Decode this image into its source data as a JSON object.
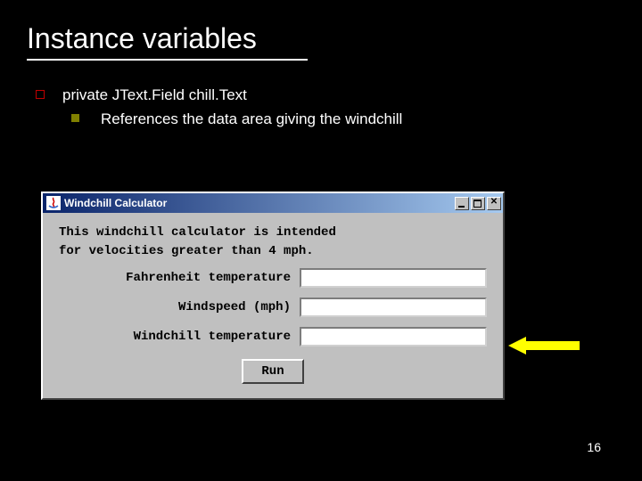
{
  "slide": {
    "title": "Instance variables",
    "page_number": "16"
  },
  "bullets": {
    "l1_text": "private JText.Field chill.Text",
    "l2_text": "References the data area giving the windchill"
  },
  "window": {
    "title": "Windchill Calculator",
    "intro_line1": "This windchill calculator is intended",
    "intro_line2": "for velocities greater than 4 mph.",
    "labels": {
      "fahrenheit": "Fahrenheit temperature",
      "windspeed": "Windspeed (mph)",
      "windchill": "Windchill temperature"
    },
    "run_label": "Run"
  }
}
